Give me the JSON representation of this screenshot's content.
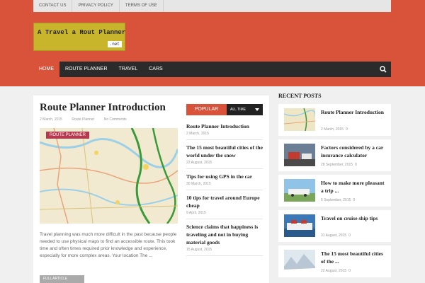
{
  "topbar": {
    "links": [
      "CONTACT US",
      "PRIVACY POLICY",
      "TERMS OF USE"
    ]
  },
  "logo": {
    "text": "A Travel a Rout Planner",
    "tld": ".net"
  },
  "nav": {
    "items": [
      "HOME",
      "ROUTE PLANNER",
      "TRAVEL",
      "CARS"
    ],
    "search_icon": "search-icon"
  },
  "post": {
    "title": "Route Planner Introduction",
    "date": "2 March, 2015",
    "category": "Route Planner",
    "comments": "No Comments",
    "badge": "ROUTE PLANNER",
    "excerpt": "Travel planning was much more difficult in the past because people needed to use physical maps to find an accessible route. This took time and often times required prior knowledge and experience, especially for more complex areas. Your location The ...",
    "more_label": "FULL ARTICLE"
  },
  "popular": {
    "tab_label": "POPULAR",
    "filter_label": "ALL TIME",
    "items": [
      {
        "title": "Route Planner Introduction",
        "date": "2 March, 2015"
      },
      {
        "title": "The 15 most beautiful cities of the world under the snow",
        "date": "22 August, 2015"
      },
      {
        "title": "Tips for using GPS in the car",
        "date": "30 March, 2015"
      },
      {
        "title": "10 tips for travel around Europe cheap",
        "date": "9 April, 2015"
      },
      {
        "title": "Science claims that happiness is traveling and not in buying material goods",
        "date": "15 August, 2015"
      }
    ]
  },
  "recent": {
    "heading": "RECENT POSTS",
    "items": [
      {
        "title": "Route Planner Introduction",
        "date": "2 March, 2015",
        "comments": "0"
      },
      {
        "title": "Factors considered by a car insurance calculator",
        "date": "28 September, 2015",
        "comments": "0"
      },
      {
        "title": "How to make more pleasant a trip ...",
        "date": "5 September, 2015",
        "comments": "0"
      },
      {
        "title": "Travel on cruise ship tips",
        "date": "31 August, 2015",
        "comments": "0"
      },
      {
        "title": "The 15 most beautiful cities of the ...",
        "date": "22 August, 2015",
        "comments": "0"
      }
    ]
  },
  "colors": {
    "accent": "#d9533a",
    "nav_bg": "#2b2b2b",
    "badge": "#b43a4f",
    "logo": "#c9b52c"
  }
}
